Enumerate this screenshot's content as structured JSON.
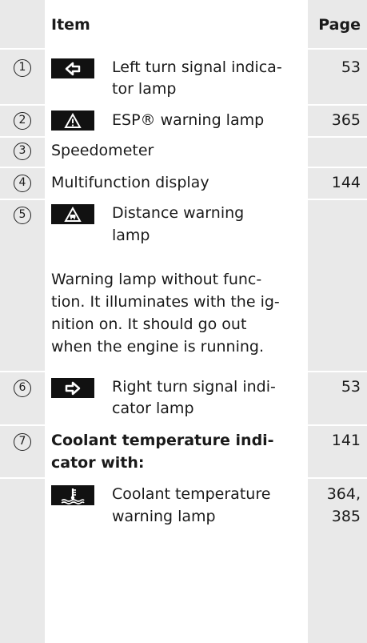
{
  "header": {
    "item": "Item",
    "page": "Page"
  },
  "rows": [
    {
      "num": "1",
      "label": "Left turn signal indica-",
      "label2": "tor lamp",
      "page": "53",
      "icon": "left-arrow-icon"
    },
    {
      "num": "2",
      "label": "ESP® warning lamp",
      "page": "365",
      "icon": "warning-triangle-icon"
    },
    {
      "num": "3",
      "label": "Speedometer"
    },
    {
      "num": "4",
      "label": "Multifunction display",
      "page": "144"
    },
    {
      "num": "5",
      "label": "Distance warning",
      "label2": "lamp",
      "icon": "distance-warning-icon",
      "note": [
        "Warning lamp without func-",
        "tion. It illuminates with the ig-",
        "nition on. It should go out",
        "when the engine is running."
      ]
    },
    {
      "num": "6",
      "label": "Right turn signal indi-",
      "label2": "cator lamp",
      "page": "53",
      "icon": "right-arrow-icon"
    },
    {
      "num": "7",
      "label": "Coolant temperature indi-",
      "label2": "cator with:",
      "page": "141"
    }
  ],
  "sub_row": {
    "label": "Coolant temperature",
    "label2": "warning lamp",
    "page": "364,",
    "page2": "385",
    "icon": "coolant-temperature-icon"
  }
}
